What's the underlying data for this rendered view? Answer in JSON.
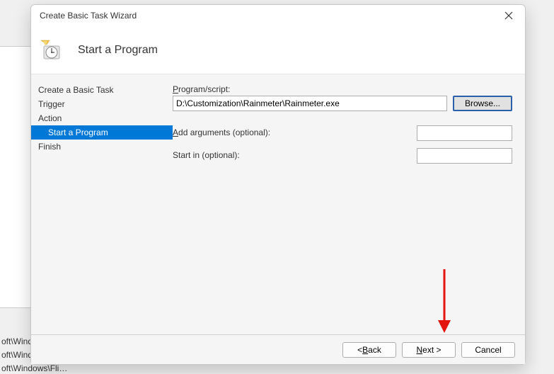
{
  "bg": {
    "line1": "oft\\Wind…",
    "line2": "oft\\Windows\\U…",
    "line3": "oft\\Windows\\Fli…"
  },
  "dialog": {
    "title": "Create Basic Task Wizard",
    "header": "Start a Program"
  },
  "sidebar": {
    "create": "Create a Basic Task",
    "trigger": "Trigger",
    "action": "Action",
    "start_program": "Start a Program",
    "finish": "Finish"
  },
  "form": {
    "program_label_pre": "P",
    "program_label_post": "rogram/script:",
    "program_value": "D:\\Customization\\Rainmeter\\Rainmeter.exe",
    "browse": "Browse...",
    "arguments_label_pre": "A",
    "arguments_label_post": "dd arguments (optional):",
    "arguments_value": "",
    "startin_label": "Start in (optional):",
    "startin_value": ""
  },
  "buttons": {
    "back_prefix": "< ",
    "back_u": "B",
    "back_rest": "ack",
    "next_u": "N",
    "next_rest": "ext >",
    "cancel": "Cancel"
  }
}
